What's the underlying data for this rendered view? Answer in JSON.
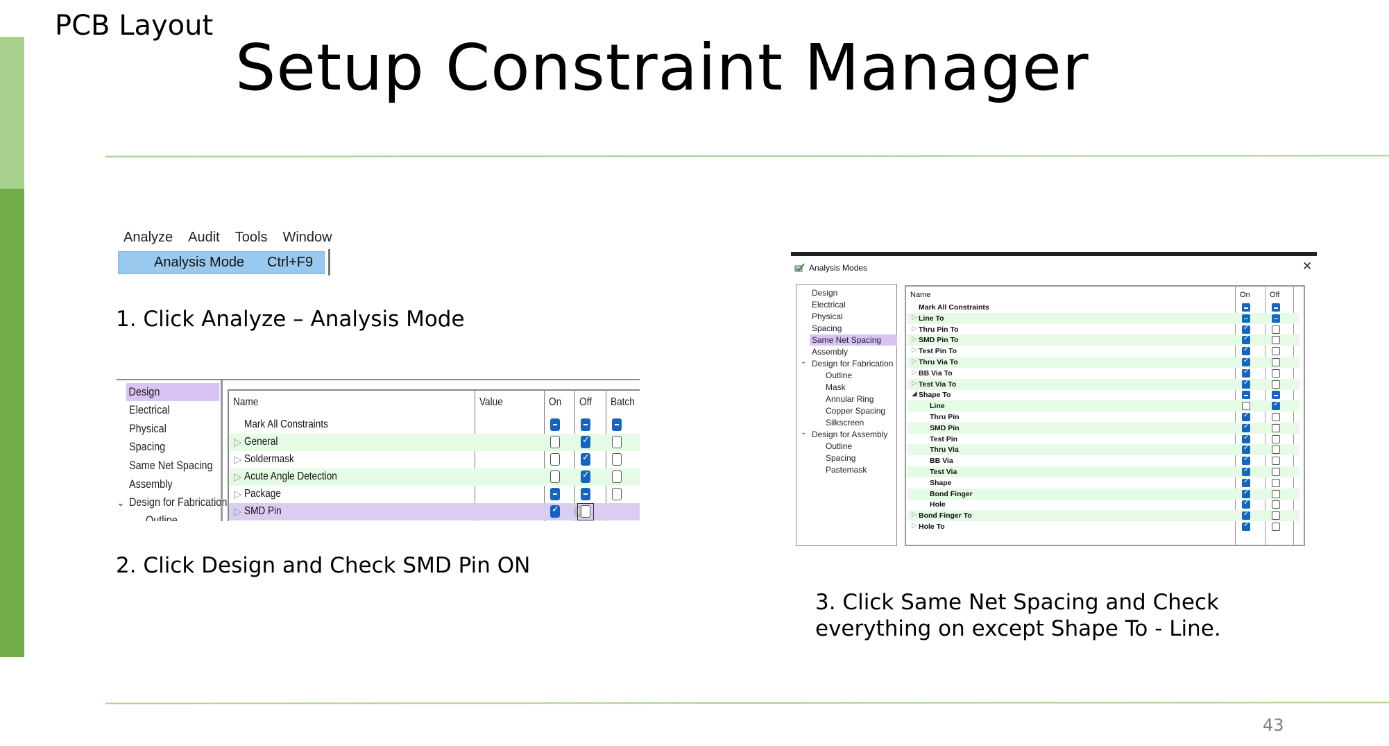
{
  "slide": {
    "section_label": "PCB Layout",
    "title": "Setup Constraint Manager",
    "page_number": "43",
    "accent_light": "#a9d18e",
    "accent_dark": "#70ad47"
  },
  "captions": {
    "step1": "1. Click Analyze – Analysis Mode",
    "step2": "2. Click Design and Check SMD Pin ON",
    "step3_line1": "3. Click Same Net Spacing and Check",
    "step3_line2": "everything on except Shape To - Line."
  },
  "menu_shot": {
    "menubar": [
      "Analyze",
      "Audit",
      "Tools",
      "Window"
    ],
    "item_label": "Analysis Mode",
    "item_shortcut": "Ctrl+F9",
    "highlight_color": "#99c9ef"
  },
  "design_shot": {
    "nav": [
      "Design",
      "Electrical",
      "Physical",
      "Spacing",
      "Same Net Spacing",
      "Assembly",
      "Design for Fabrication",
      "Outline"
    ],
    "selected_nav": "Design",
    "columns": [
      "Name",
      "Value",
      "On",
      "Off",
      "Batch"
    ],
    "rows": [
      {
        "name": "Mark All Constraints",
        "on": "mixed",
        "off": "mixed",
        "batch": "mixed"
      },
      {
        "name": "General",
        "on": "unchecked",
        "off": "checked",
        "batch": "unchecked"
      },
      {
        "name": "Soldermask",
        "on": "unchecked",
        "off": "checked",
        "batch": "unchecked"
      },
      {
        "name": "Acute Angle Detection",
        "on": "unchecked",
        "off": "checked",
        "batch": "unchecked"
      },
      {
        "name": "Package",
        "on": "mixed",
        "off": "mixed",
        "batch": "unchecked"
      },
      {
        "name": "SMD Pin",
        "on": "checked",
        "off": "unchecked",
        "batch": ""
      }
    ]
  },
  "analysis_dialog": {
    "title": "Analysis Modes",
    "close_glyph": "✕",
    "nav": [
      "Design",
      "Electrical",
      "Physical",
      "Spacing",
      "Same Net Spacing",
      "Assembly",
      "Design for Fabrication",
      "Outline",
      "Mask",
      "Annular Ring",
      "Copper Spacing",
      "Silkscreen",
      "Design for Assembly",
      "Outline",
      "Spacing",
      "Pastemask"
    ],
    "selected_nav": "Same Net Spacing",
    "columns": [
      "Name",
      "On",
      "Off"
    ],
    "rows": [
      {
        "name": "Mark All Constraints",
        "on": "mixed",
        "off": "mixed"
      },
      {
        "name": "Line To",
        "on": "mixed",
        "off": "mixed"
      },
      {
        "name": "Thru Pin To",
        "on": "checked",
        "off": "unchecked"
      },
      {
        "name": "SMD Pin To",
        "on": "checked",
        "off": "unchecked"
      },
      {
        "name": "Test Pin To",
        "on": "checked",
        "off": "unchecked"
      },
      {
        "name": "Thru Via To",
        "on": "checked",
        "off": "unchecked"
      },
      {
        "name": "BB Via To",
        "on": "checked",
        "off": "unchecked"
      },
      {
        "name": "Test Via To",
        "on": "checked",
        "off": "unchecked"
      },
      {
        "name": "Shape To",
        "on": "mixed",
        "off": "mixed"
      },
      {
        "name": "Line",
        "on": "unchecked",
        "off": "checked"
      },
      {
        "name": "Thru Pin",
        "on": "checked",
        "off": "unchecked"
      },
      {
        "name": "SMD Pin",
        "on": "checked",
        "off": "unchecked"
      },
      {
        "name": "Test Pin",
        "on": "checked",
        "off": "unchecked"
      },
      {
        "name": "Thru Via",
        "on": "checked",
        "off": "unchecked"
      },
      {
        "name": "BB Via",
        "on": "checked",
        "off": "unchecked"
      },
      {
        "name": "Test Via",
        "on": "checked",
        "off": "unchecked"
      },
      {
        "name": "Shape",
        "on": "checked",
        "off": "unchecked"
      },
      {
        "name": "Bond Finger",
        "on": "checked",
        "off": "unchecked"
      },
      {
        "name": "Hole",
        "on": "checked",
        "off": "unchecked"
      },
      {
        "name": "Bond Finger To",
        "on": "checked",
        "off": "unchecked"
      },
      {
        "name": "Hole To",
        "on": "checked",
        "off": "unchecked"
      }
    ]
  }
}
